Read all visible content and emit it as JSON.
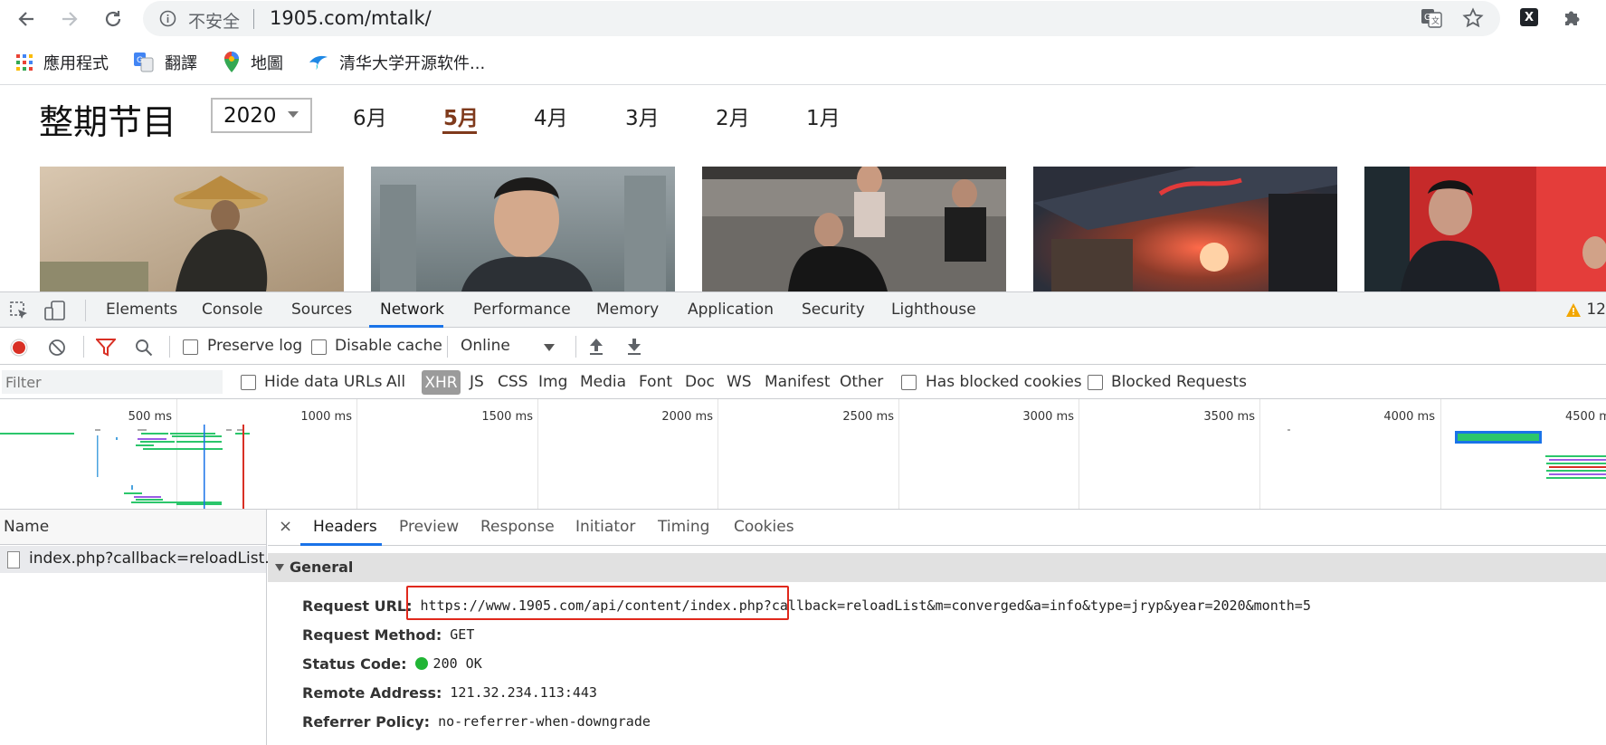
{
  "browser": {
    "insecure_label": "不安全",
    "url": "1905.com/mtalk/",
    "ext_label": "X"
  },
  "bookmarks": [
    {
      "label": "應用程式",
      "icon": "apps-grid-icon"
    },
    {
      "label": "翻譯",
      "icon": "google-translate-icon"
    },
    {
      "label": "地圖",
      "icon": "maps-pin-icon"
    },
    {
      "label": "清华大学开源软件...",
      "icon": "tsinghua-bird-icon"
    }
  ],
  "page": {
    "title": "整期节目",
    "year": "2020",
    "months": [
      "6月",
      "5月",
      "4月",
      "3月",
      "2月",
      "1月"
    ],
    "active_month": "5月"
  },
  "devtools": {
    "tabs": [
      "Elements",
      "Console",
      "Sources",
      "Network",
      "Performance",
      "Memory",
      "Application",
      "Security",
      "Lighthouse"
    ],
    "active_tab": "Network",
    "warning_count": "12",
    "toolbar": {
      "preserve_log": "Preserve log",
      "disable_cache": "Disable cache",
      "throttle": "Online"
    },
    "filter": {
      "placeholder": "Filter",
      "hide_data_urls": "Hide data URLs",
      "types": [
        "All",
        "XHR",
        "JS",
        "CSS",
        "Img",
        "Media",
        "Font",
        "Doc",
        "WS",
        "Manifest",
        "Other"
      ],
      "active_type": "XHR",
      "has_blocked_cookies": "Has blocked cookies",
      "blocked_requests": "Blocked Requests"
    },
    "timeline_ticks": [
      "500 ms",
      "1000 ms",
      "1500 ms",
      "2000 ms",
      "2500 ms",
      "3000 ms",
      "3500 ms",
      "4000 ms",
      "4500 m"
    ],
    "name_header": "Name",
    "request_name": "index.php?callback=reloadList...",
    "detail_tabs": [
      "Headers",
      "Preview",
      "Response",
      "Initiator",
      "Timing",
      "Cookies"
    ],
    "active_detail_tab": "Headers",
    "close_glyph": "×",
    "general": {
      "section_title": "General",
      "request_url_label": "Request URL:",
      "request_url_value": "https://www.1905.com/api/content/index.php?callback=reloadList&m=converged&a=info&type=jryp&year=2020&month=5",
      "request_method_label": "Request Method:",
      "request_method_value": "GET",
      "status_code_label": "Status Code:",
      "status_code_value": "200 OK",
      "remote_address_label": "Remote Address:",
      "remote_address_value": "121.32.234.113:443",
      "referrer_policy_label": "Referrer Policy:",
      "referrer_policy_value": "no-referrer-when-downgrade"
    }
  },
  "colors": {
    "accent": "#1a73e8",
    "active_month": "#7f3a1c",
    "highlight_box": "#e0281c",
    "status_ok": "#21b535"
  }
}
